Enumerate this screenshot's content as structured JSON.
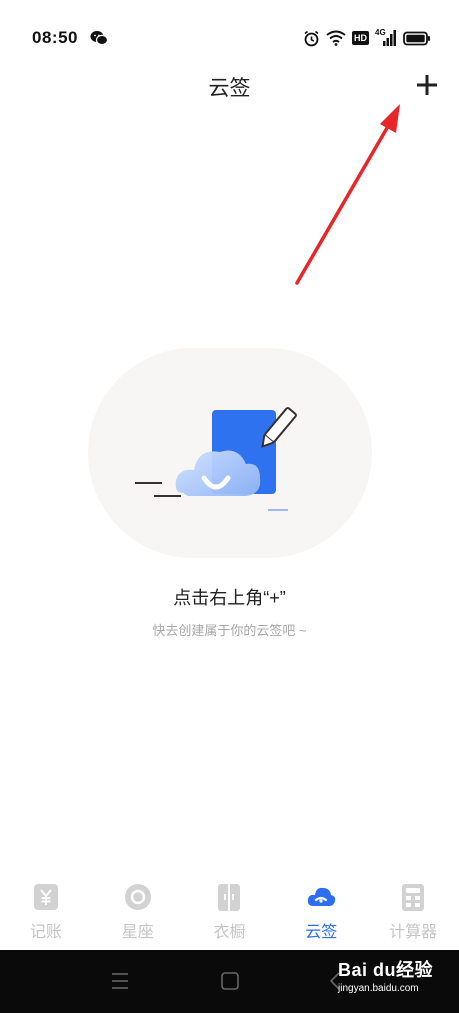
{
  "status": {
    "time": "08:50",
    "hd_badge": "HD",
    "network": "4G"
  },
  "header": {
    "title": "云签"
  },
  "empty_state": {
    "title": "点击右上角“+”",
    "subtitle": "快去创建属于你的云签吧 ~"
  },
  "tabs": [
    {
      "label": "记账",
      "icon": "ledger-icon",
      "active": false
    },
    {
      "label": "星座",
      "icon": "constellation-icon",
      "active": false
    },
    {
      "label": "衣橱",
      "icon": "wardrobe-icon",
      "active": false
    },
    {
      "label": "云签",
      "icon": "cloud-note-icon",
      "active": true
    },
    {
      "label": "计算器",
      "icon": "calculator-icon",
      "active": false
    }
  ],
  "watermark": {
    "brand": "Bai du经验",
    "url": "jingyan.baidu.com"
  },
  "colors": {
    "accent": "#2d6ef0",
    "inactive": "#c6c6c6",
    "arrow": "#e8262a"
  }
}
